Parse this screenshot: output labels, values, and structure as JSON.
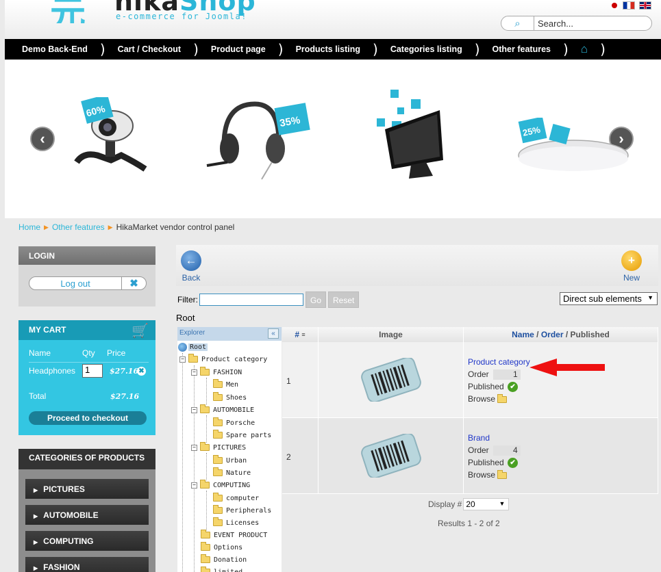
{
  "header": {
    "logo_word_a": "hika",
    "logo_word_b": "Shop",
    "logo_tagline": "e-commerce for Joomla!",
    "search_placeholder": "Search..."
  },
  "nav": {
    "items": [
      "Demo Back-End",
      "Cart / Checkout",
      "Product page",
      "Products listing",
      "Categories listing",
      "Other features"
    ]
  },
  "breadcrumb": {
    "home": "Home",
    "parent": "Other features",
    "current": "HikaMarket vendor control panel"
  },
  "login": {
    "title": "LOGIN",
    "logout_label": "Log out"
  },
  "cart": {
    "title": "MY CART",
    "col_name": "Name",
    "col_qty": "Qty",
    "col_price": "Price",
    "item_name": "Headphones",
    "item_qty": "1",
    "item_price": "$27.16",
    "total_label": "Total",
    "total_value": "$27.16",
    "checkout_label": "Proceed to checkout"
  },
  "categories": {
    "title": "CATEGORIES OF PRODUCTS",
    "items": [
      "PICTURES",
      "AUTOMOBILE",
      "COMPUTING",
      "FASHION"
    ]
  },
  "toolbar": {
    "back_label": "Back",
    "new_label": "New"
  },
  "filter": {
    "label": "Filter:",
    "go_label": "Go",
    "reset_label": "Reset",
    "scope_select": "Direct sub elements"
  },
  "listing_title": "Root",
  "tree": {
    "header": "Explorer",
    "collapse": "«",
    "root": "Root",
    "product_category": "Product category",
    "fashion": "FASHION",
    "men": "Men",
    "shoes": "Shoes",
    "automobile": "AUTOMOBILE",
    "porsche": "Porsche",
    "spare_parts": "Spare parts",
    "pictures": "PICTURES",
    "urban": "Urban",
    "nature": "Nature",
    "computing": "COMPUTING",
    "computer": "computer",
    "peripherals": "Peripherals",
    "licenses": "Licenses",
    "event_product": "EVENT PRODUCT",
    "options": "Options",
    "donation": "Donation",
    "limited": "limited"
  },
  "grid": {
    "col_num": "#",
    "col_image": "Image",
    "col_name": "Name",
    "col_sep1": " / ",
    "col_order": "Order",
    "col_sep2": " / ",
    "col_published": "Published",
    "order_label": "Order",
    "published_label": "Published",
    "browse_label": "Browse",
    "rows": [
      {
        "num": "1",
        "name": "Product category",
        "order": "1"
      },
      {
        "num": "2",
        "name": "Brand",
        "order": "4"
      }
    ]
  },
  "footer": {
    "display_label": "Display #",
    "display_value": "20",
    "results": "Results 1 - 2 of 2"
  },
  "slider": {
    "badge_webcam": "60%",
    "badge_headset": "35%",
    "badge_mouse": "25%"
  },
  "colors": {
    "accent": "#2bb6d8",
    "nav_bg": "#000000",
    "cart_bg": "#33c6e2",
    "link": "#1f36c8",
    "breadcrumb_arrow": "#f39323",
    "annotation_arrow": "#ee1111"
  }
}
